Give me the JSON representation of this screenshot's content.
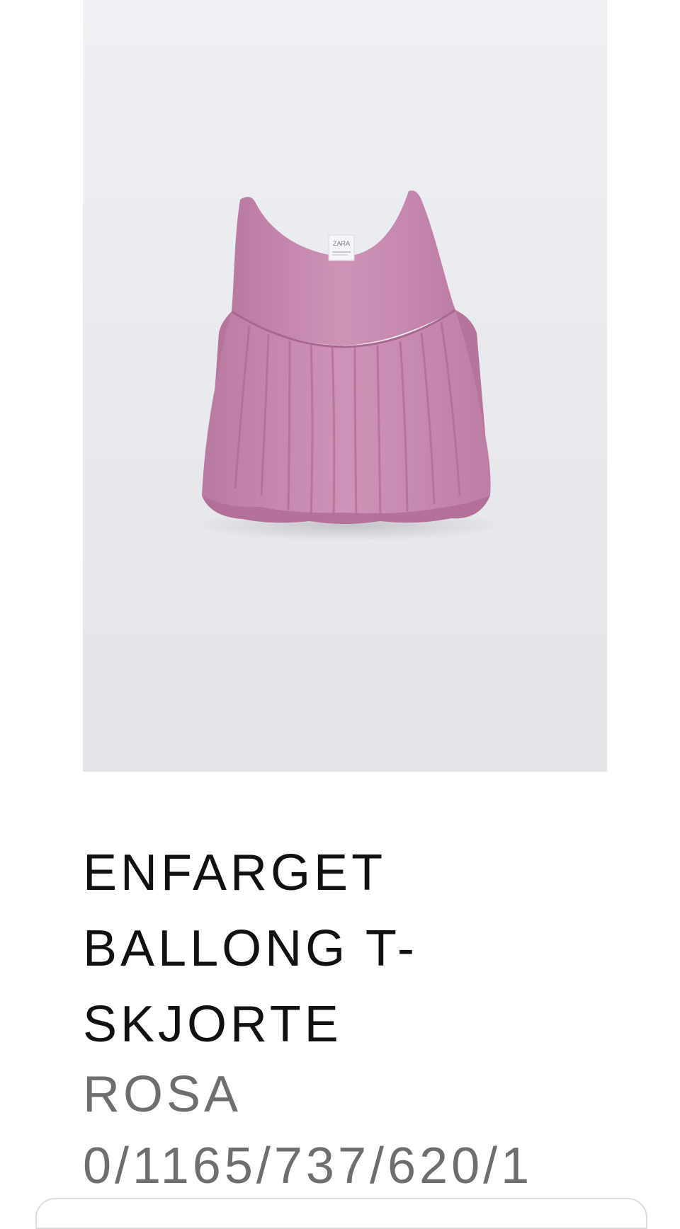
{
  "product": {
    "image": {
      "icon": "pink-balloon-sleeveless-top-photo",
      "brand_label": "ZARA"
    },
    "name": "ENFARGET BALLONG T-SKJORTE",
    "color": "ROSA",
    "reference": "0/1165/737/620/1"
  },
  "colors": {
    "background": "#ffffff",
    "image_bg": "#e9ebef",
    "garment": "#c98bb1",
    "title_text": "#111111",
    "secondary_text": "#6e6e6e"
  }
}
